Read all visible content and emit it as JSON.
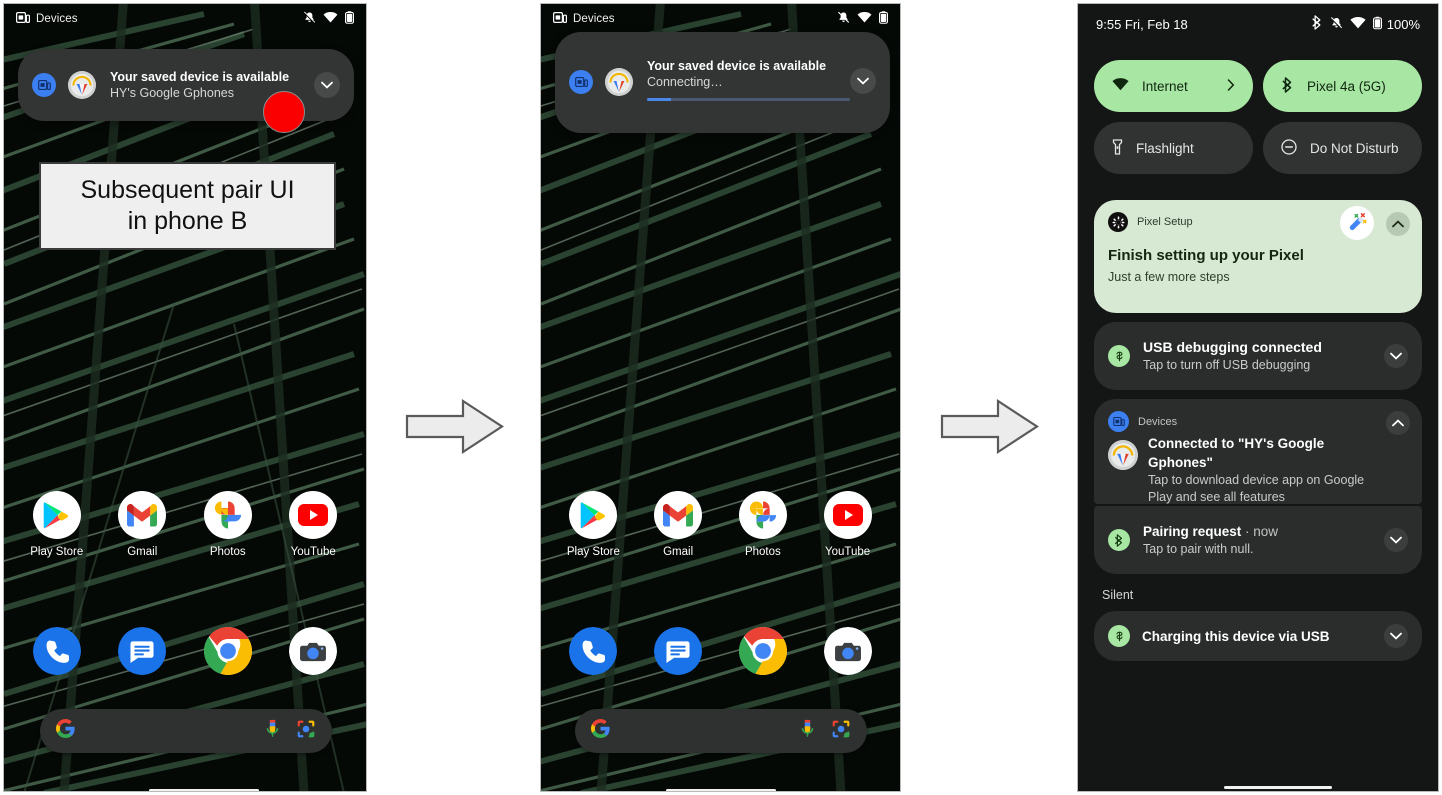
{
  "figure": {
    "background": "#ffffff",
    "arrow_fill": "#ececec",
    "arrow_stroke": "#5a5a5a"
  },
  "callout": {
    "line1": "Subsequent pair UI",
    "line2": "in phone B"
  },
  "phone_a": {
    "statusbar": {
      "app_label": "Devices",
      "icons": [
        "devices-icon",
        "vibrate-off-icon",
        "wifi-icon",
        "battery-icon"
      ]
    },
    "notification": {
      "title": "Your saved device is available",
      "subtitle": "HY's Google Gphones",
      "small_icon": "devices-icon",
      "avatar": "headphones-avatar",
      "expand_icon": "chevron-down-icon"
    },
    "apps_row1": [
      {
        "label": "Play Store",
        "icon": "play-store-icon"
      },
      {
        "label": "Gmail",
        "icon": "gmail-icon"
      },
      {
        "label": "Photos",
        "icon": "google-photos-icon"
      },
      {
        "label": "YouTube",
        "icon": "youtube-icon"
      }
    ],
    "dock": [
      {
        "label": "Phone",
        "icon": "phone-icon"
      },
      {
        "label": "Messages",
        "icon": "messages-icon"
      },
      {
        "label": "Chrome",
        "icon": "chrome-icon"
      },
      {
        "label": "Camera",
        "icon": "camera-icon"
      }
    ],
    "search": {
      "g_icon": "google-g-icon",
      "mic_icon": "microphone-icon",
      "lens_icon": "google-lens-icon",
      "placeholder": ""
    }
  },
  "phone_b": {
    "statusbar": {
      "app_label": "Devices",
      "icons": [
        "devices-icon",
        "vibrate-off-icon",
        "wifi-icon",
        "battery-icon"
      ]
    },
    "notification": {
      "title": "Your saved device is available",
      "subtitle": "Connecting…",
      "small_icon": "devices-icon",
      "avatar": "headphones-avatar",
      "expand_icon": "chevron-down-icon",
      "progress_percent": 12
    },
    "apps_row1": [
      {
        "label": "Play Store",
        "icon": "play-store-icon"
      },
      {
        "label": "Gmail",
        "icon": "gmail-icon"
      },
      {
        "label": "Photos",
        "icon": "google-photos-icon"
      },
      {
        "label": "YouTube",
        "icon": "youtube-icon"
      }
    ],
    "dock": [
      {
        "label": "Phone",
        "icon": "phone-icon"
      },
      {
        "label": "Messages",
        "icon": "messages-icon"
      },
      {
        "label": "Chrome",
        "icon": "chrome-icon"
      },
      {
        "label": "Camera",
        "icon": "camera-icon"
      }
    ]
  },
  "phone_c": {
    "statusbar": {
      "time": "9:55 Fri, Feb 18",
      "battery_percent": "100%",
      "icons": [
        "bluetooth-icon",
        "vibrate-off-icon",
        "wifi-icon",
        "battery-icon"
      ]
    },
    "quick_settings": [
      {
        "label": "Internet",
        "icon": "wifi-icon",
        "state": "on",
        "chevron": "chevron-right-icon"
      },
      {
        "label": "Pixel 4a (5G)",
        "icon": "bluetooth-icon",
        "state": "on"
      },
      {
        "label": "Flashlight",
        "icon": "flashlight-icon",
        "state": "off"
      },
      {
        "label": "Do Not Disturb",
        "icon": "do-not-disturb-icon",
        "state": "off"
      }
    ],
    "notifications": [
      {
        "kind": "setup",
        "app": "Pixel Setup",
        "app_icon": "pixel-setup-gear-icon",
        "badge_icon": "magic-wand-icon",
        "title": "Finish setting up your Pixel",
        "sub": "Just a few more steps",
        "chevron": "chevron-up-icon"
      },
      {
        "kind": "plain",
        "app_icon": "usb-icon",
        "title": "USB debugging connected",
        "sub": "Tap to turn off USB debugging",
        "chevron": "chevron-down-icon"
      },
      {
        "kind": "devices",
        "app": "Devices",
        "app_icon": "devices-icon",
        "avatar": "headphones-avatar",
        "title": "Connected to \"HY's Google Gphones\"",
        "sub": "Tap to download device app on Google Play and see all features",
        "chevron": "chevron-up-icon"
      },
      {
        "kind": "pairing",
        "app_icon": "bluetooth-icon",
        "title": "Pairing request",
        "time": "now",
        "sub": "Tap to pair with null.",
        "chevron": "chevron-down-icon"
      }
    ],
    "silent_section": {
      "label": "Silent",
      "items": [
        {
          "app_icon": "usb-icon",
          "title": "Charging this device via USB",
          "chevron": "chevron-down-icon"
        }
      ]
    }
  }
}
